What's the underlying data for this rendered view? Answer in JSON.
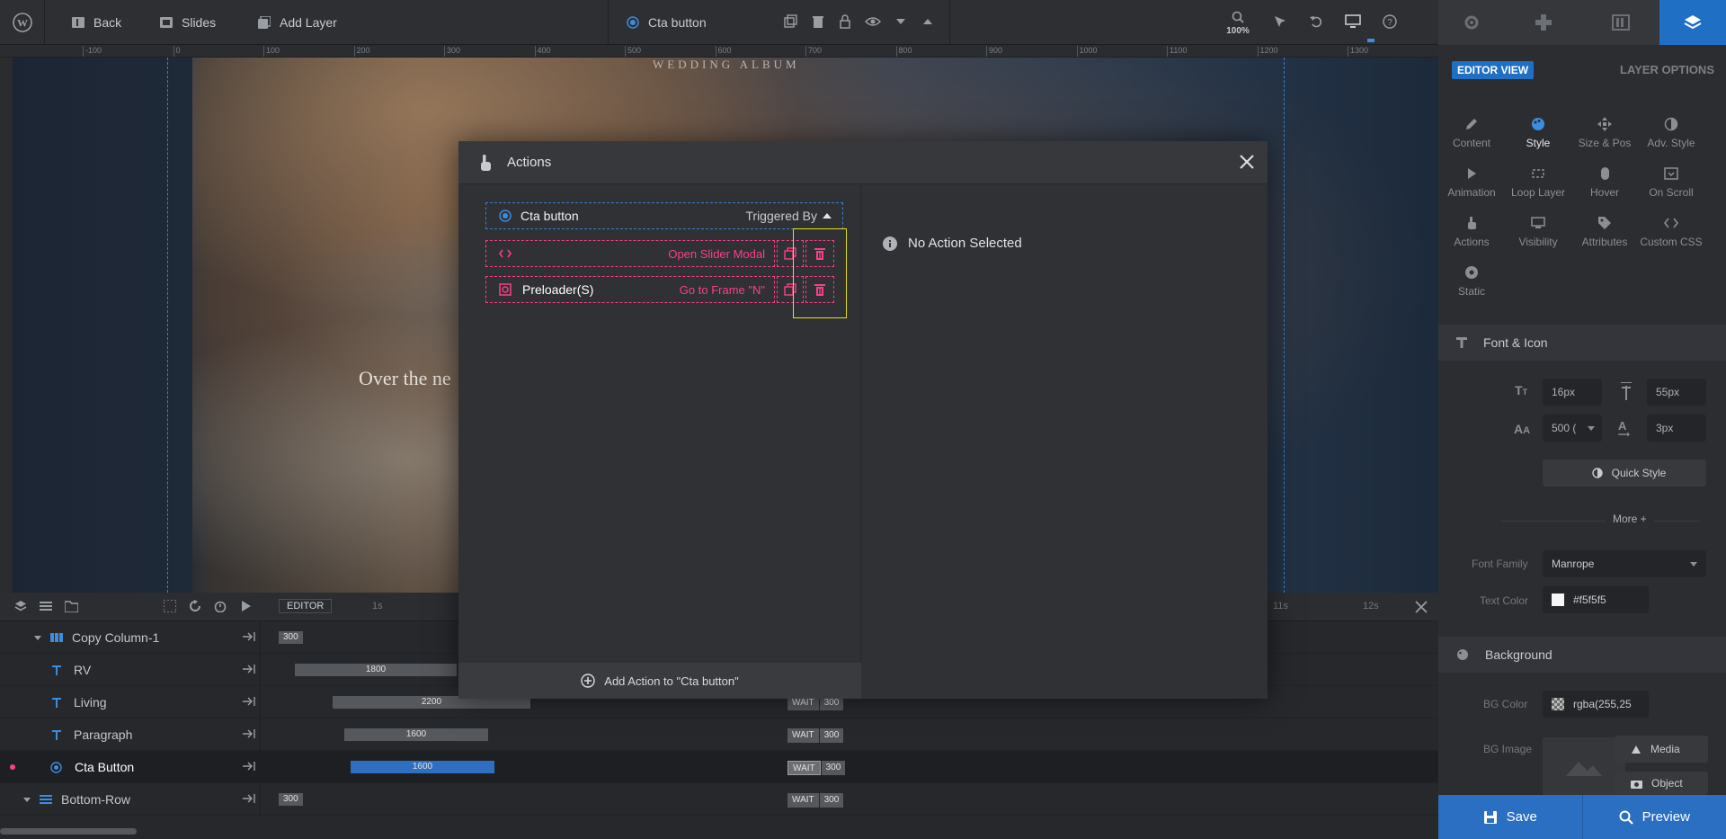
{
  "topbar": {
    "back_label": "Back",
    "slides_label": "Slides",
    "add_layer_label": "Add Layer",
    "layer_name": "Cta button",
    "zoom": "100%"
  },
  "ruler": {
    "ticks": [
      "-100",
      "0",
      "100",
      "200",
      "300",
      "400",
      "500",
      "600",
      "700",
      "800",
      "900",
      "1000",
      "1100",
      "1200",
      "1300"
    ]
  },
  "canvas": {
    "heading": "WEDDING ALBUM",
    "body_text": "Over the ne"
  },
  "modal": {
    "title": "Actions",
    "trigger_layer": "Cta button",
    "triggered_by_label": "Triggered By",
    "actions": [
      {
        "target": "",
        "action": "Open Slider Modal"
      },
      {
        "target": "Preloader(S)",
        "action": "Go to Frame \"N\""
      }
    ],
    "empty_state": "No Action Selected",
    "add_action_label": "Add Action to \"Cta button\""
  },
  "right_panel": {
    "editor_view_label": "EDITOR VIEW",
    "layer_options_label": "LAYER OPTIONS",
    "options": [
      {
        "label": "Content",
        "icon": "pen-icon"
      },
      {
        "label": "Style",
        "icon": "palette-icon",
        "active": true
      },
      {
        "label": "Size & Pos",
        "icon": "move-icon"
      },
      {
        "label": "Adv. Style",
        "icon": "contrast-icon"
      },
      {
        "label": "Animation",
        "icon": "play-icon"
      },
      {
        "label": "Loop Layer",
        "icon": "loop-icon"
      },
      {
        "label": "Hover",
        "icon": "mouse-icon"
      },
      {
        "label": "On Scroll",
        "icon": "scroll-icon"
      },
      {
        "label": "Actions",
        "icon": "hand-pointer-icon"
      },
      {
        "label": "Visibility",
        "icon": "visibility-icon"
      },
      {
        "label": "Attributes",
        "icon": "tag-icon"
      },
      {
        "label": "Custom CSS",
        "icon": "code-icon"
      },
      {
        "label": "Static",
        "icon": "static-icon"
      }
    ],
    "font_section": {
      "title": "Font & Icon",
      "font_size": "16px",
      "line_height": "55px",
      "font_weight": "500 (",
      "letter_spacing": "3px",
      "quick_style": "Quick Style",
      "more_label": "More",
      "font_family_label": "Font Family",
      "font_family": "Manrope",
      "text_color_label": "Text Color",
      "text_color": "#f5f5f5"
    },
    "background_section": {
      "title": "Background",
      "bg_color_label": "BG Color",
      "bg_color": "rgba(255,25",
      "bg_image_label": "BG Image",
      "media_label": "Media",
      "object_label": "Object"
    },
    "save_label": "Save",
    "preview_label": "Preview"
  },
  "timeline": {
    "editor_label": "EDITOR",
    "markers": [
      "1s",
      "11s",
      "12s"
    ],
    "rows": [
      {
        "name": "Copy Column-1",
        "value": "300"
      },
      {
        "name": "RV",
        "value": "1800"
      },
      {
        "name": "Living",
        "value": "2200",
        "wait": "WAIT",
        "wait_value": "300"
      },
      {
        "name": "Paragraph",
        "value": "1600",
        "wait": "WAIT",
        "wait_value": "300"
      },
      {
        "name": "Cta Button",
        "value": "1600",
        "wait": "WAIT",
        "wait_value": "300"
      },
      {
        "name": "Bottom-Row",
        "value": "300",
        "wait": "WAIT",
        "wait_value": "300"
      }
    ]
  }
}
